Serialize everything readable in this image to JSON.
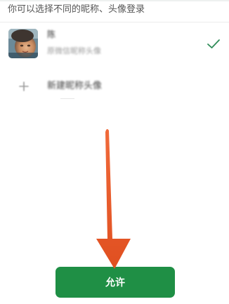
{
  "prompt": "你可以选择不同的昵称、头像登录",
  "account": {
    "name": "陈",
    "description": "原微信昵称头像",
    "selected": true
  },
  "new_identity": {
    "label": "新建昵称头像"
  },
  "allow_button": {
    "label": "允许"
  },
  "colors": {
    "accent": "#1f8f45",
    "check": "#2e8b57",
    "annotation_arrow": "#e8572a"
  },
  "icons": [
    "check-icon",
    "plus-icon",
    "avatar",
    "annotation-arrow"
  ]
}
